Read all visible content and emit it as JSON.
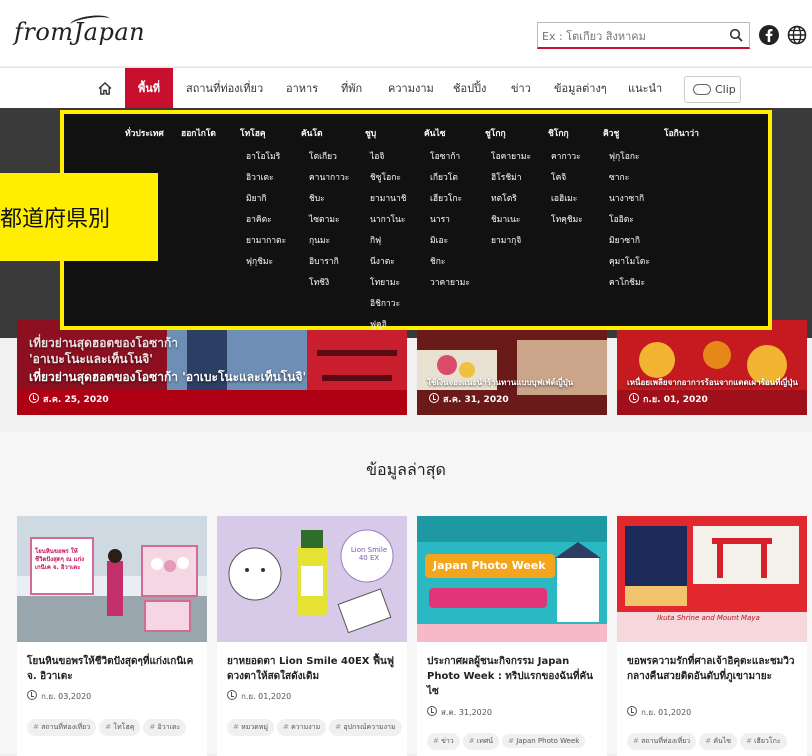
{
  "header": {
    "logo_text": "fromJapan",
    "search_placeholder": "Ex : โตเกียว สิงหาคม"
  },
  "nav": {
    "items": [
      {
        "label": "พื้นที่",
        "active": true
      },
      {
        "label": "สถานที่ท่องเที่ยว"
      },
      {
        "label": "อาหาร"
      },
      {
        "label": "ที่พัก"
      },
      {
        "label": "ความงาม"
      },
      {
        "label": "ช้อปปิ้ง"
      },
      {
        "label": "ข่าว"
      },
      {
        "label": "ข้อมูลต่างๆ"
      },
      {
        "label": "แนะนำ"
      }
    ],
    "clip_label": "Clip"
  },
  "regions": {
    "label_overlay": "都道府県別",
    "columns": [
      {
        "head": "ทั่วประเทศ",
        "items": []
      },
      {
        "head": "ฮอกไกโด",
        "items": []
      },
      {
        "head": "โทโฮคุ",
        "items": [
          "อาโอโมริ",
          "อิวาเตะ",
          "มิยากิ",
          "อาคิตะ",
          "ยามากาตะ",
          "ฟุกุชิมะ"
        ]
      },
      {
        "head": "คันโต",
        "items": [
          "โตเกียว",
          "คานากาวะ",
          "ชิบะ",
          "ไซตามะ",
          "กุนมะ",
          "อิบารากิ",
          "โทชิงิ"
        ]
      },
      {
        "head": "ชูบุ",
        "items": [
          "ไอจิ",
          "ชิซูโอกะ",
          "ยามานาชิ",
          "นากาโนะ",
          "กิฟุ",
          "นีงาตะ",
          "โทยามะ",
          "อิชิกาวะ",
          "ฟุคุอิ"
        ]
      },
      {
        "head": "คันไซ",
        "items": [
          "โอซาก้า",
          "เกียวโต",
          "เฮียวโกะ",
          "นารา",
          "มิเอะ",
          "ชิกะ",
          "วาคายามะ"
        ]
      },
      {
        "head": "ชูโกกุ",
        "items": [
          "โอคายามะ",
          "ฮิโรชิม่า",
          "ทตโตริ",
          "ชิมาเนะ",
          "ยามากุจิ"
        ]
      },
      {
        "head": "ชิโกกุ",
        "items": [
          "คากาวะ",
          "โคจิ",
          "เอฮิเมะ",
          "โทคุชิมะ"
        ]
      },
      {
        "head": "คิวชู",
        "items": [
          "ฟุกุโอกะ",
          "ซากะ",
          "นางาซากิ",
          "โออิตะ",
          "มิยาซากิ",
          "คุมาโมโตะ",
          "คาโกชิมะ"
        ]
      },
      {
        "head": "โอกินาว่า",
        "items": []
      }
    ]
  },
  "featured": [
    {
      "title_top": "เที่ยวย่านสุดฮอตของโอซาก้า",
      "title_mid": "'อาเบะโนะและเท็นโนจิ'",
      "title": "เที่ยวย่านสุดฮอตของโอซาก้า 'อาเบะโนะและเท็นโนจิ'",
      "date": "ส.ค. 25, 2020"
    },
    {
      "title": "ใช้เงินจองแนะนำร้านทานแบบบุฟเฟ่ต์ญี่ปุ่น",
      "date": "ส.ค. 31, 2020"
    },
    {
      "title": "เหนื่อยเพลียจากอาการร้อนจากแดดเผาร้อนที่ญี่ปุ่น",
      "date": "ก.ย. 01, 2020"
    }
  ],
  "latest": {
    "title": "ข้อมูลล่าสุด",
    "cards": [
      {
        "title": "โยนหินขอพรให้ชีวิตปังสุดๆที่แก่งเกนิเค จ. อิวาเตะ",
        "date": "ก.ย. 03,2020",
        "tags": [
          "สถานที่ท่องเที่ยว",
          "โทโฮคุ",
          "อิวาเตะ"
        ],
        "img_caption": "โยนหินขอพร ให้ชีวิตปังสุดๆ ณ แก่งเกนิเค จ. อิวาเตะ"
      },
      {
        "title": "ยาหยอดตา Lion Smile 40EX ฟื้นฟูดวงตาให้สดใสดังเดิม",
        "date": "ก.ย. 01,2020",
        "tags": [
          "หมวดหมู่",
          "ความงาม",
          "อุปกรณ์ความงาม"
        ],
        "img_caption": "Lion Smile 40 EX"
      },
      {
        "title": "ประกาศผลผู้ชนะกิจกรรม Japan Photo Week : ทริปแรกของฉันที่คันไซ",
        "date": "ส.ค. 31,2020",
        "tags": [
          "ข่าว",
          "เทศน์",
          "Japan Photo Week"
        ],
        "img_caption": "Japan Photo Week"
      },
      {
        "title": "ขอพรความรักที่ศาลเจ้าอิคุตะและชมวิวกลางคืนสวยติดอันดับที่ภูเขามายะ",
        "date": "ก.ย. 01,2020",
        "tags": [
          "สถานที่ท่องเที่ยว",
          "คันไซ",
          "เฮียวโกะ"
        ],
        "img_caption": "Ikuta Shrine and Mount Maya"
      }
    ]
  },
  "colors": {
    "brand_red": "#c8102e",
    "highlight_yellow": "#ffee00",
    "dropdown_bg": "#111111"
  }
}
